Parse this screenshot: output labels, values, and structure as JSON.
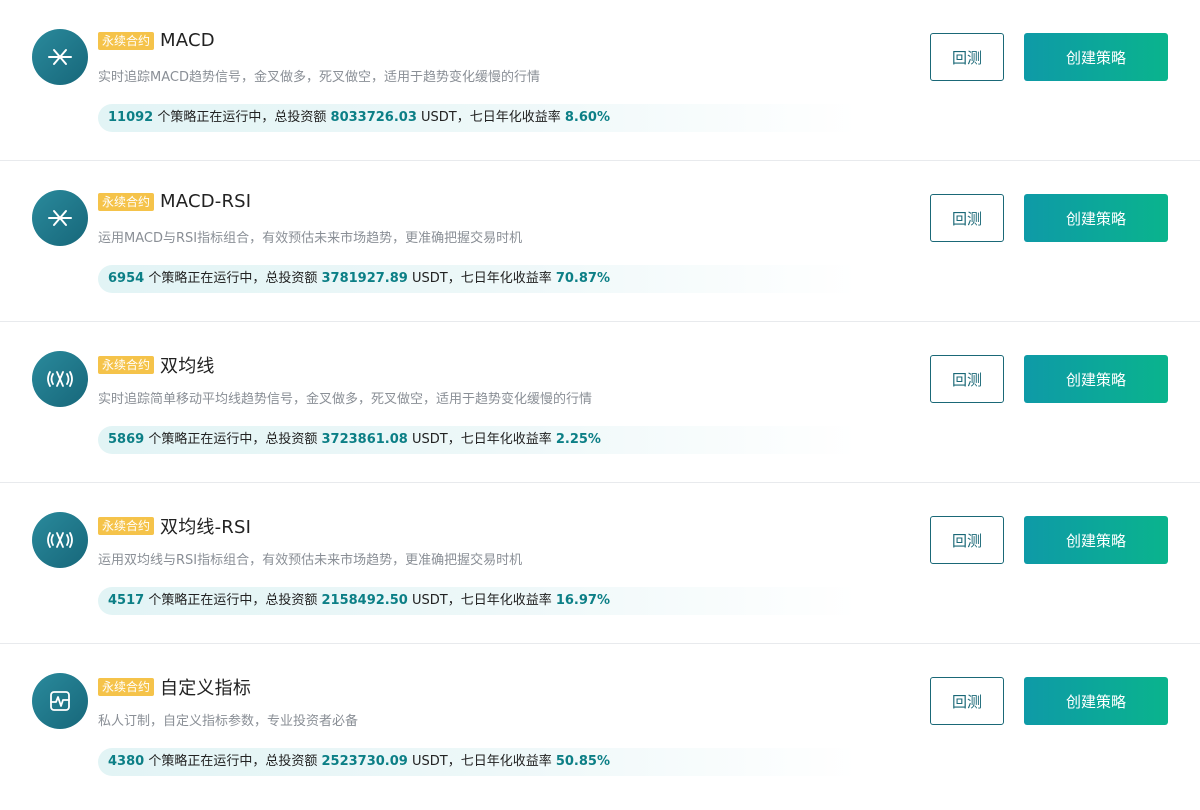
{
  "tag_label": "永续合约",
  "backtest_label": "回测",
  "create_label": "创建策略",
  "stat_text": {
    "running": "个策略正在运行中，总投资额",
    "usdt": "USDT，七日年化收益率"
  },
  "colors": {
    "accent": "#0c7f86",
    "tag_bg": "#f5c34a",
    "button_gradient_start": "#0e9aa7",
    "button_gradient_end": "#0ab48d",
    "icon_bg": "#1d7587"
  },
  "strategies": [
    {
      "icon": "macd-cross-icon",
      "title": "MACD",
      "description": "实时追踪MACD趋势信号，金叉做多，死叉做空，适用于趋势变化缓慢的行情",
      "count": "11092",
      "investment": "8033726.03",
      "rate": "8.60%"
    },
    {
      "icon": "macd-cross-icon",
      "title": "MACD-RSI",
      "description": "运用MACD与RSI指标组合，有效预估未来市场趋势，更准确把握交易时机",
      "count": "6954",
      "investment": "3781927.89",
      "rate": "70.87%"
    },
    {
      "icon": "dual-ma-signal-icon",
      "title": "双均线",
      "description": "实时追踪简单移动平均线趋势信号，金叉做多，死叉做空，适用于趋势变化缓慢的行情",
      "count": "5869",
      "investment": "3723861.08",
      "rate": "2.25%"
    },
    {
      "icon": "dual-ma-signal-icon",
      "title": "双均线-RSI",
      "description": "运用双均线与RSI指标组合，有效预估未来市场趋势，更准确把握交易时机",
      "count": "4517",
      "investment": "2158492.50",
      "rate": "16.97%"
    },
    {
      "icon": "custom-indicator-icon",
      "title": "自定义指标",
      "description": "私人订制，自定义指标参数，专业投资者必备",
      "count": "4380",
      "investment": "2523730.09",
      "rate": "50.85%"
    }
  ]
}
